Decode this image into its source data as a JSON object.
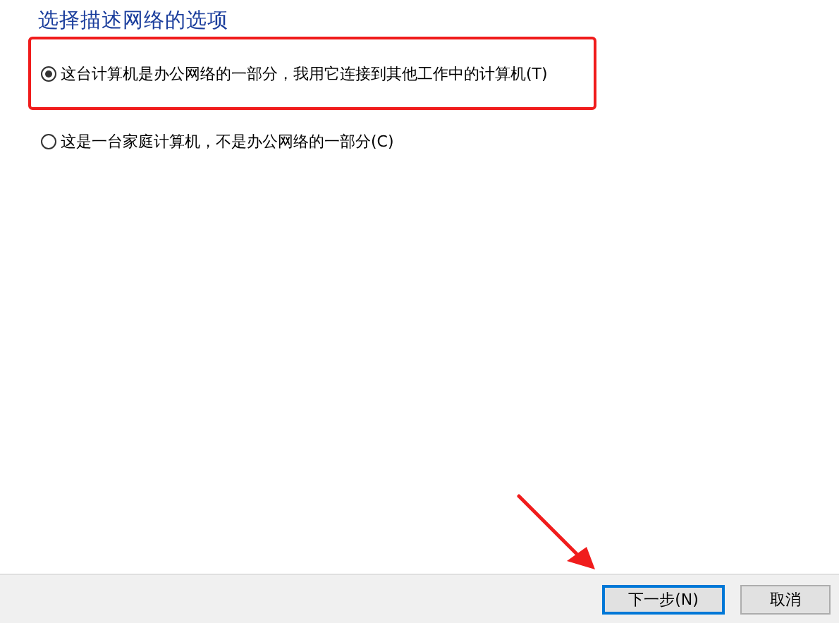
{
  "heading": "选择描述网络的选项",
  "options": [
    {
      "label": "这台计算机是办公网络的一部分，我用它连接到其他工作中的计算机(T)",
      "selected": true,
      "highlighted": true
    },
    {
      "label": "这是一台家庭计算机，不是办公网络的一部分(C)",
      "selected": false,
      "highlighted": false
    }
  ],
  "buttons": [
    {
      "label": "下一步(N)",
      "kind": "default"
    },
    {
      "label": "取消",
      "kind": "normal"
    }
  ]
}
